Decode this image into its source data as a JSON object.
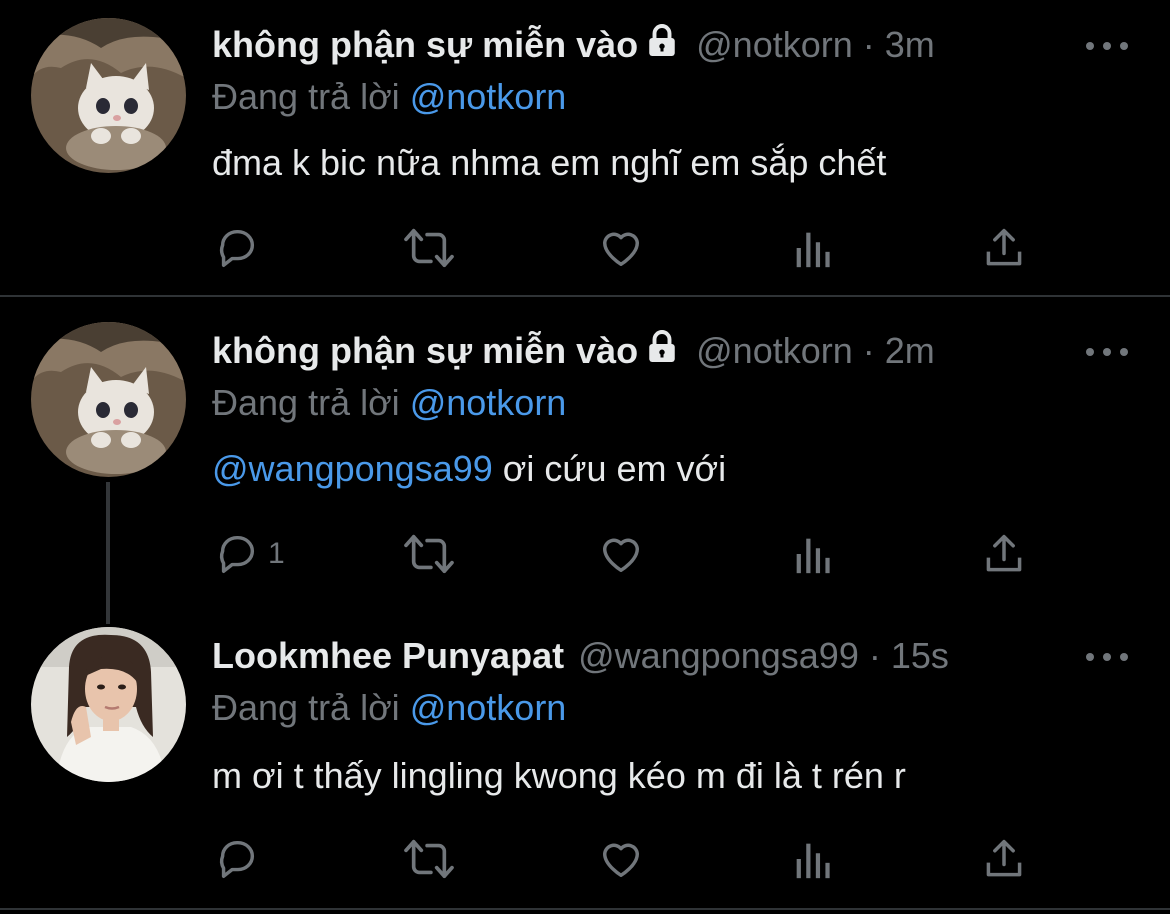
{
  "tweets": [
    {
      "name": "không phận sự miễn vào",
      "handle": "@notkorn",
      "dot": "·",
      "time": "3m",
      "reply_prefix": "Đang trả lời",
      "reply_to": "@notkorn",
      "text_mention": "",
      "text": "đma k bic nữa nhma em nghĩ em sắp chết",
      "reply_count": "",
      "locked": true,
      "avatar": "kitten"
    },
    {
      "name": "không phận sự miễn vào",
      "handle": "@notkorn",
      "dot": "·",
      "time": "2m",
      "reply_prefix": "Đang trả lời",
      "reply_to": "@notkorn",
      "text_mention": "@wangpongsa99",
      "text": " ơi cứu em với",
      "reply_count": "1",
      "locked": true,
      "avatar": "kitten"
    },
    {
      "name": "Lookmhee Punyapat",
      "handle": "@wangpongsa99",
      "dot": "·",
      "time": "15s",
      "reply_prefix": "Đang trả lời",
      "reply_to": "@notkorn",
      "text_mention": "",
      "text": "m ơi t thấy lingling kwong kéo m đi là t rén r",
      "reply_count": "",
      "locked": false,
      "avatar": "person"
    }
  ],
  "icons": {
    "reply": "reply-icon",
    "retweet": "retweet-icon",
    "like": "heart-icon",
    "views": "views-icon",
    "share": "share-icon",
    "more": "more-icon",
    "lock": "lock-icon"
  },
  "colors": {
    "background": "#000000",
    "text": "#e7e9ea",
    "muted": "#71767b",
    "link": "#4a99e9",
    "divider": "#2f3336"
  }
}
